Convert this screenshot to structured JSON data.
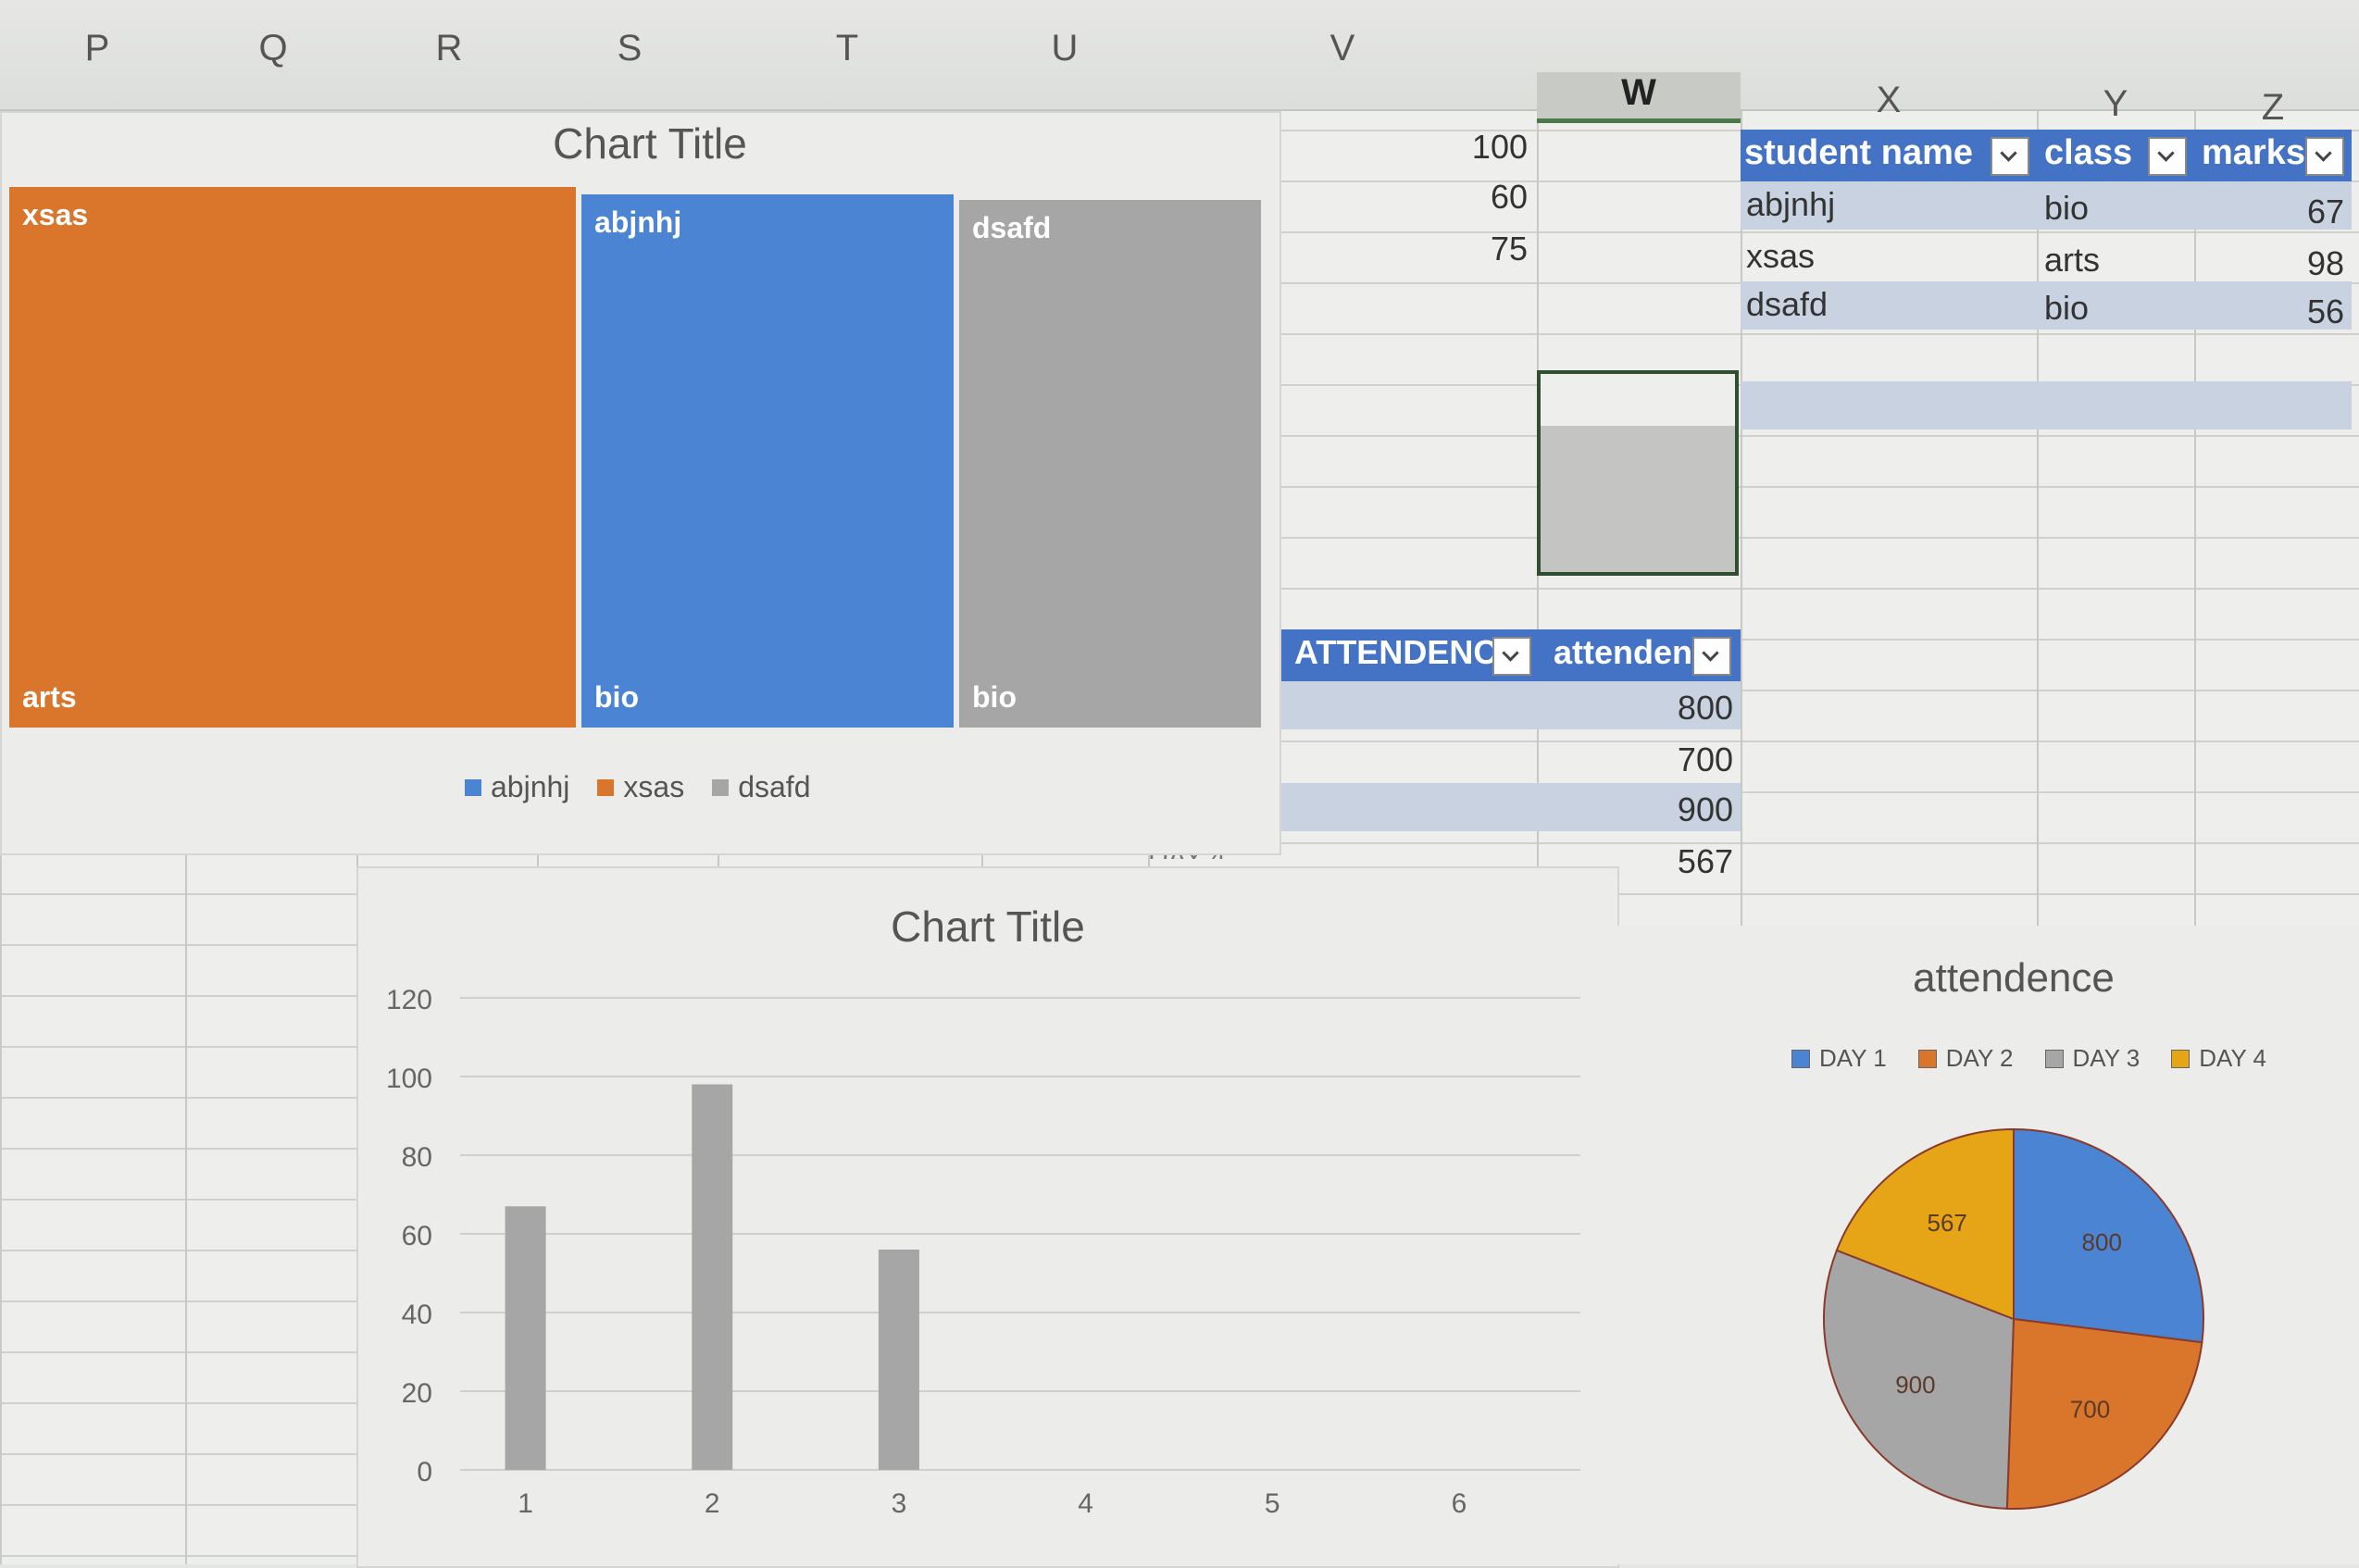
{
  "column_headers": [
    "P",
    "Q",
    "R",
    "S",
    "T",
    "U",
    "V",
    "W",
    "X",
    "Y",
    "Z"
  ],
  "active_column": "W",
  "v_column_values": [
    "100",
    "60",
    "75"
  ],
  "student_table": {
    "headers": [
      "student name",
      "class",
      "marks"
    ],
    "rows": [
      {
        "name": "abjnhj",
        "class": "bio",
        "marks": "67"
      },
      {
        "name": "xsas",
        "class": "arts",
        "marks": "98"
      },
      {
        "name": "dsafd",
        "class": "bio",
        "marks": "56"
      }
    ]
  },
  "attendance_table": {
    "headers": [
      "ATTENDENC",
      "attenden"
    ],
    "values": [
      "800",
      "700",
      "900",
      "567"
    ],
    "partial_label": "DAY 4"
  },
  "colors": {
    "orange": "#d9762b",
    "blue": "#4a84d2",
    "gray": "#a6a6a6",
    "gold": "#e6a516",
    "header_blue": "#4472c4"
  },
  "chart_data": [
    {
      "type": "treemap",
      "title": "Chart Title",
      "legend": [
        "abjnhj",
        "xsas",
        "dsafd"
      ],
      "items": [
        {
          "name": "xsas",
          "group": "arts",
          "value": 98,
          "color": "#d9762b"
        },
        {
          "name": "abjnhj",
          "group": "bio",
          "value": 67,
          "color": "#4a84d2"
        },
        {
          "name": "dsafd",
          "group": "bio",
          "value": 56,
          "color": "#a6a6a6"
        }
      ]
    },
    {
      "type": "bar",
      "title": "Chart Title",
      "categories": [
        "1",
        "2",
        "3",
        "4",
        "5",
        "6"
      ],
      "values": [
        67,
        98,
        56,
        null,
        null,
        null
      ],
      "ylim": [
        0,
        120
      ],
      "yticks": [
        "0",
        "20",
        "40",
        "60",
        "80",
        "100",
        "120"
      ],
      "grid": true
    },
    {
      "type": "pie",
      "title": "attendence",
      "labels": [
        "DAY 1",
        "DAY 2",
        "DAY 3",
        "DAY 4"
      ],
      "values": [
        800,
        700,
        900,
        567
      ],
      "colors": [
        "#4a84d2",
        "#d9762b",
        "#a6a6a6",
        "#e6a516"
      ],
      "legend_position": "top"
    }
  ]
}
